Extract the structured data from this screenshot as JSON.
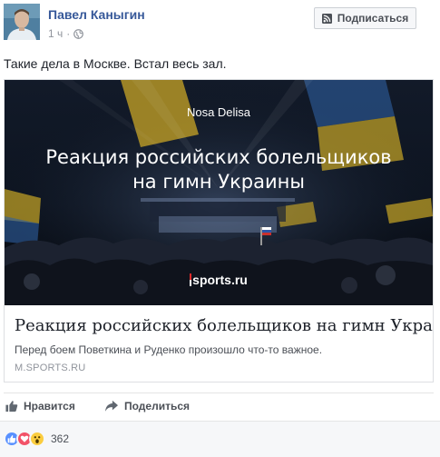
{
  "header": {
    "author_name": "Павел Каныгин",
    "timestamp": "1 ч",
    "privacy_icon": "globe-icon",
    "follow_label": "Подписаться",
    "follow_icon": "rss-icon"
  },
  "post": {
    "text": "Такие дела в Москве. Встал весь зал."
  },
  "link_card": {
    "image_author": "Nosa Delisa",
    "image_title_line1": "Реакция российских болельщиков",
    "image_title_line2": "на гимн Украины",
    "image_brand": "sports.ru",
    "title": "Реакция российских болельщиков на гимн Украины",
    "description": "Перед боем Поветкина и Руденко произошло что-то важное.",
    "domain": "M.SPORTS.RU"
  },
  "actions": {
    "like_label": "Нравится",
    "like_icon": "thumbs-up-icon",
    "share_label": "Поделиться",
    "share_icon": "share-arrow-icon"
  },
  "reactions": {
    "icons": [
      "like-reaction-icon",
      "love-reaction-icon",
      "wow-reaction-icon"
    ],
    "count": "362"
  },
  "colors": {
    "link_blue": "#365899",
    "like_blue": "#5890ff",
    "love_red": "#f25268",
    "wow_yellow": "#fbcd3f",
    "muted_text": "#90949c"
  }
}
